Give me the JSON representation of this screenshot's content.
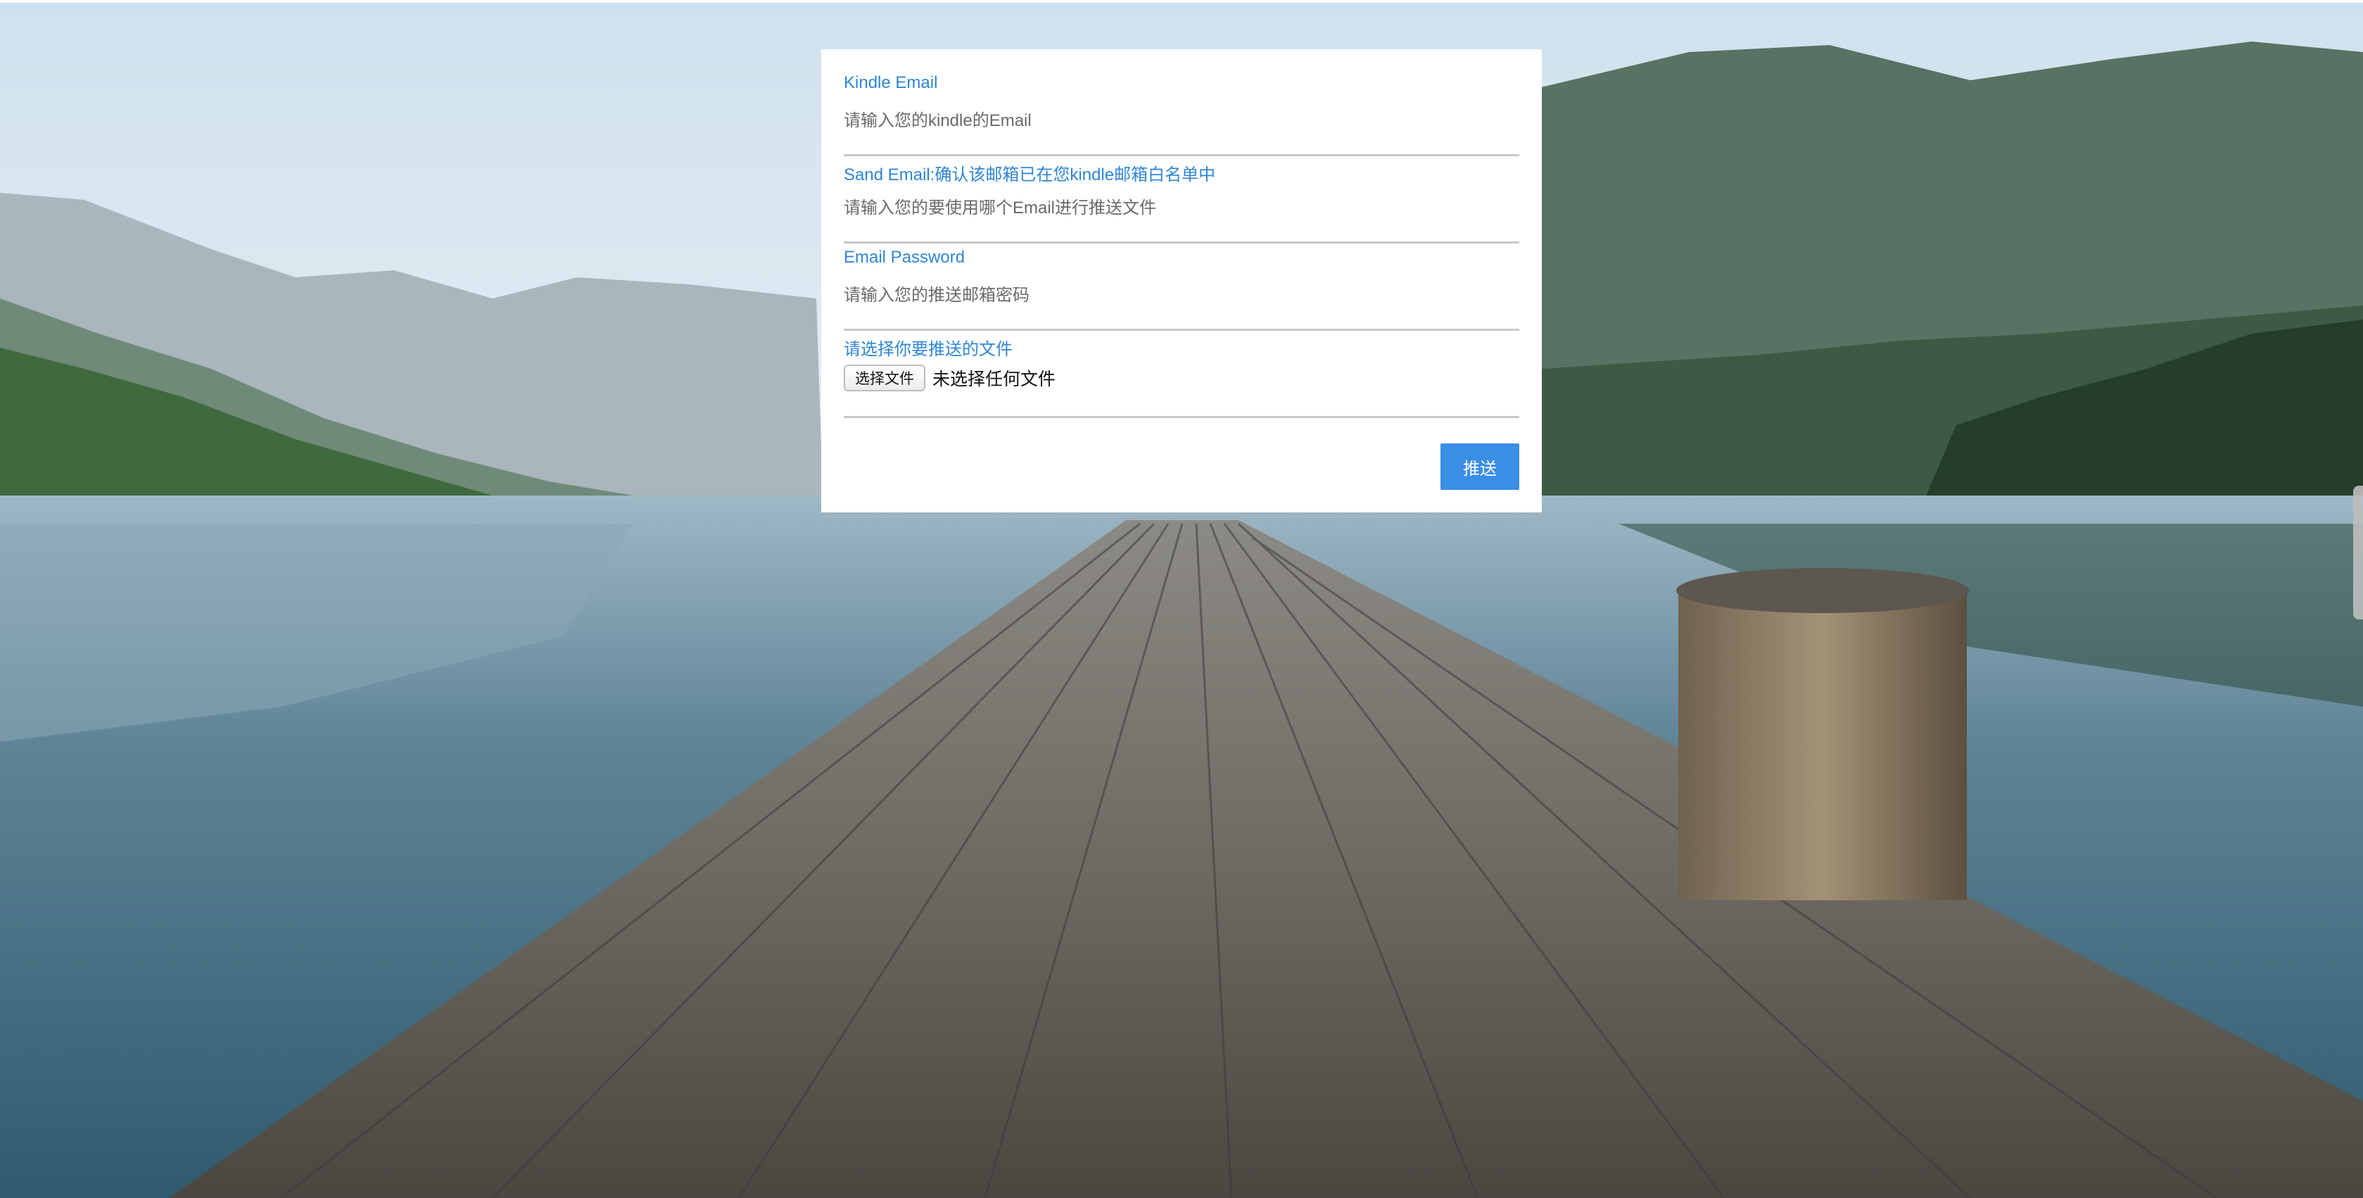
{
  "form": {
    "kindle_email": {
      "label": "Kindle Email",
      "placeholder": "请输入您的kindle的Email",
      "value": ""
    },
    "send_email": {
      "label": "Sand Email:确认该邮箱已在您kindle邮箱白名单中",
      "placeholder": "请输入您的要使用哪个Email进行推送文件",
      "value": ""
    },
    "email_password": {
      "label": "Email Password",
      "placeholder": "请输入您的推送邮箱密码",
      "value": ""
    },
    "file": {
      "label": "请选择你要推送的文件",
      "button_label": "选择文件",
      "status": "未选择任何文件"
    },
    "submit_label": "推送"
  },
  "colors": {
    "label": "#2f86d6",
    "submit_background": "#3a8ee6",
    "divider": "#c8c8c8"
  },
  "background": "lake-dock-photo"
}
